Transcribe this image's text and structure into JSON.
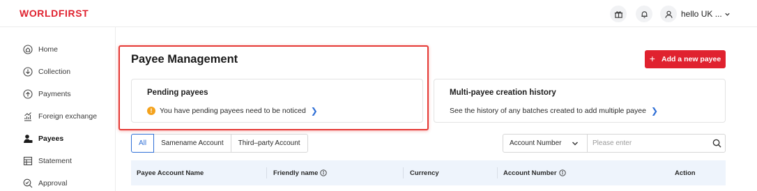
{
  "header": {
    "logo": "WORLDFIRST",
    "user_name": "hello UK ..."
  },
  "sidebar": {
    "items": [
      {
        "label": "Home",
        "icon": "home-icon"
      },
      {
        "label": "Collection",
        "icon": "collection-icon"
      },
      {
        "label": "Payments",
        "icon": "payments-icon"
      },
      {
        "label": "Foreign exchange",
        "icon": "fx-icon"
      },
      {
        "label": "Payees",
        "icon": "payees-icon",
        "active": true
      },
      {
        "label": "Statement",
        "icon": "statement-icon"
      },
      {
        "label": "Approval",
        "icon": "approval-icon"
      }
    ]
  },
  "main": {
    "title": "Payee Management",
    "add_button": "Add a new payee",
    "pending_card": {
      "title": "Pending payees",
      "message": "You have pending payees need to be noticed"
    },
    "history_card": {
      "title": "Multi-payee creation history",
      "message": "See the history of any batches created to add multiple payee"
    },
    "tabs": [
      "All",
      "Samename Account",
      "Third–party Account"
    ],
    "search": {
      "field": "Account Number",
      "placeholder": "Please enter"
    },
    "table": {
      "columns": [
        "Payee Account Name",
        "Friendly name",
        "Currency",
        "Account Number",
        "Action"
      ]
    }
  },
  "colors": {
    "brand": "#e0222f",
    "link": "#2f6fd6",
    "table_header_bg": "#eef4fc",
    "highlight": "#e53935"
  }
}
